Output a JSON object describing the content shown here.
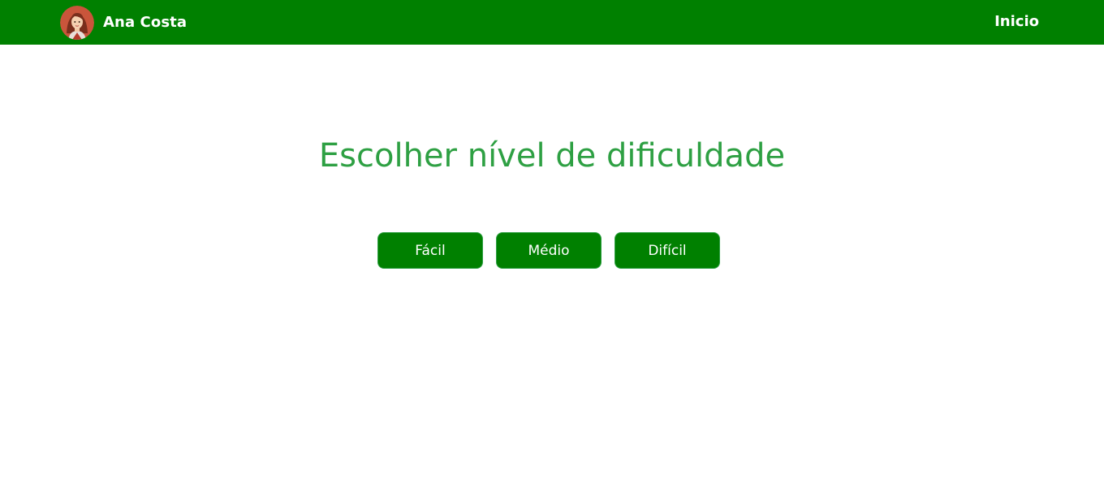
{
  "colors": {
    "navbar": "#008000",
    "title": "#2ea043",
    "button_bg": "#008000",
    "button_text": "#ffffff"
  },
  "header": {
    "avatar_icon": "user-avatar-icon",
    "user_name": "Ana Costa",
    "home_link": "Inicio"
  },
  "main": {
    "title": "Escolher nível de dificuldade",
    "levels": [
      {
        "label": "Fácil"
      },
      {
        "label": "Médio"
      },
      {
        "label": "Difícil"
      }
    ]
  }
}
